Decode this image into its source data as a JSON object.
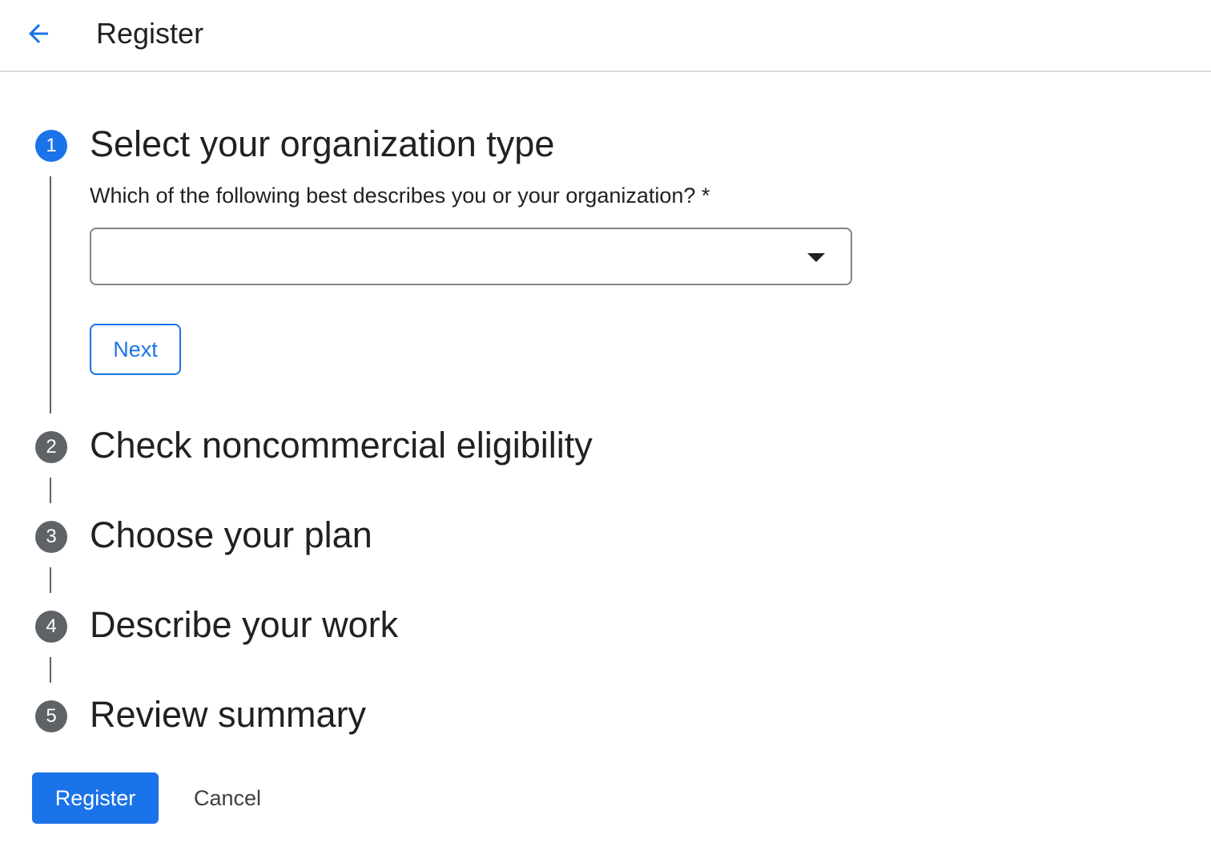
{
  "header": {
    "back_icon": "arrow-left-icon",
    "title": "Register",
    "accent_color": "#1a73e8"
  },
  "stepper": {
    "steps": [
      {
        "number": "1",
        "title": "Select your organization type",
        "state": "active"
      },
      {
        "number": "2",
        "title": "Check noncommercial eligibility",
        "state": "inactive"
      },
      {
        "number": "3",
        "title": "Choose your plan",
        "state": "inactive"
      },
      {
        "number": "4",
        "title": "Describe your work",
        "state": "inactive"
      },
      {
        "number": "5",
        "title": "Review summary",
        "state": "inactive"
      }
    ],
    "active_color": "#1a73e8",
    "inactive_color": "#5f6368"
  },
  "step1": {
    "question": "Which of the following best describes you or your organization? *",
    "select_value": "",
    "dropdown_icon": "caret-down-icon",
    "next_label": "Next"
  },
  "footer": {
    "register_label": "Register",
    "cancel_label": "Cancel"
  }
}
